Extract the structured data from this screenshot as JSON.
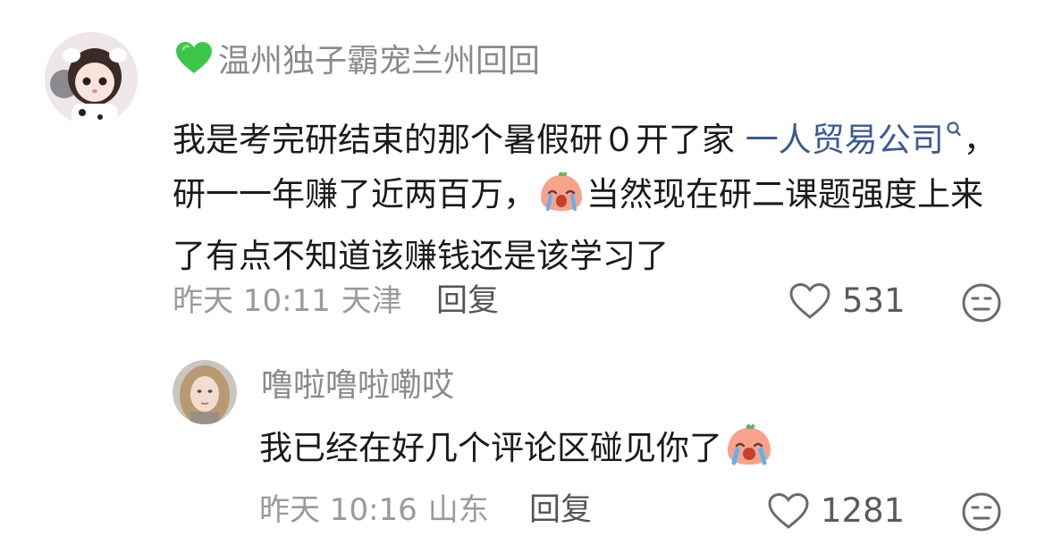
{
  "comments": [
    {
      "username": "温州独子霸宠兰州回回",
      "badge_icon": "green-heart-icon",
      "text_before_link": "我是考完研结束的那个暑假研０开了家 ",
      "link_text": "一人贸易公司",
      "text_after_link_1": "，研一一年赚了近两百万，",
      "emoji": "crying-emoji-icon",
      "text_after_link_2": "当然现在研二课题强度上来了有点不知道该赚钱还是该学习了",
      "time": "昨天 10:11",
      "location": "天津",
      "reply_label": "回复",
      "likes": "531",
      "like_icon": "heart-outline-icon",
      "dislike_icon": "meh-face-icon"
    },
    {
      "username": "噜啦噜啦嘞哎",
      "text": "我已经在好几个评论区碰见你了",
      "emoji": "crying-emoji-icon",
      "time": "昨天 10:16",
      "location": "山东",
      "reply_label": "回复",
      "likes": "1281",
      "like_icon": "heart-outline-icon",
      "dislike_icon": "meh-face-icon"
    }
  ],
  "colors": {
    "username": "#8a8a8a",
    "link": "#3a5a95",
    "meta": "#9a9a9a",
    "badge": "#3cc74a"
  }
}
